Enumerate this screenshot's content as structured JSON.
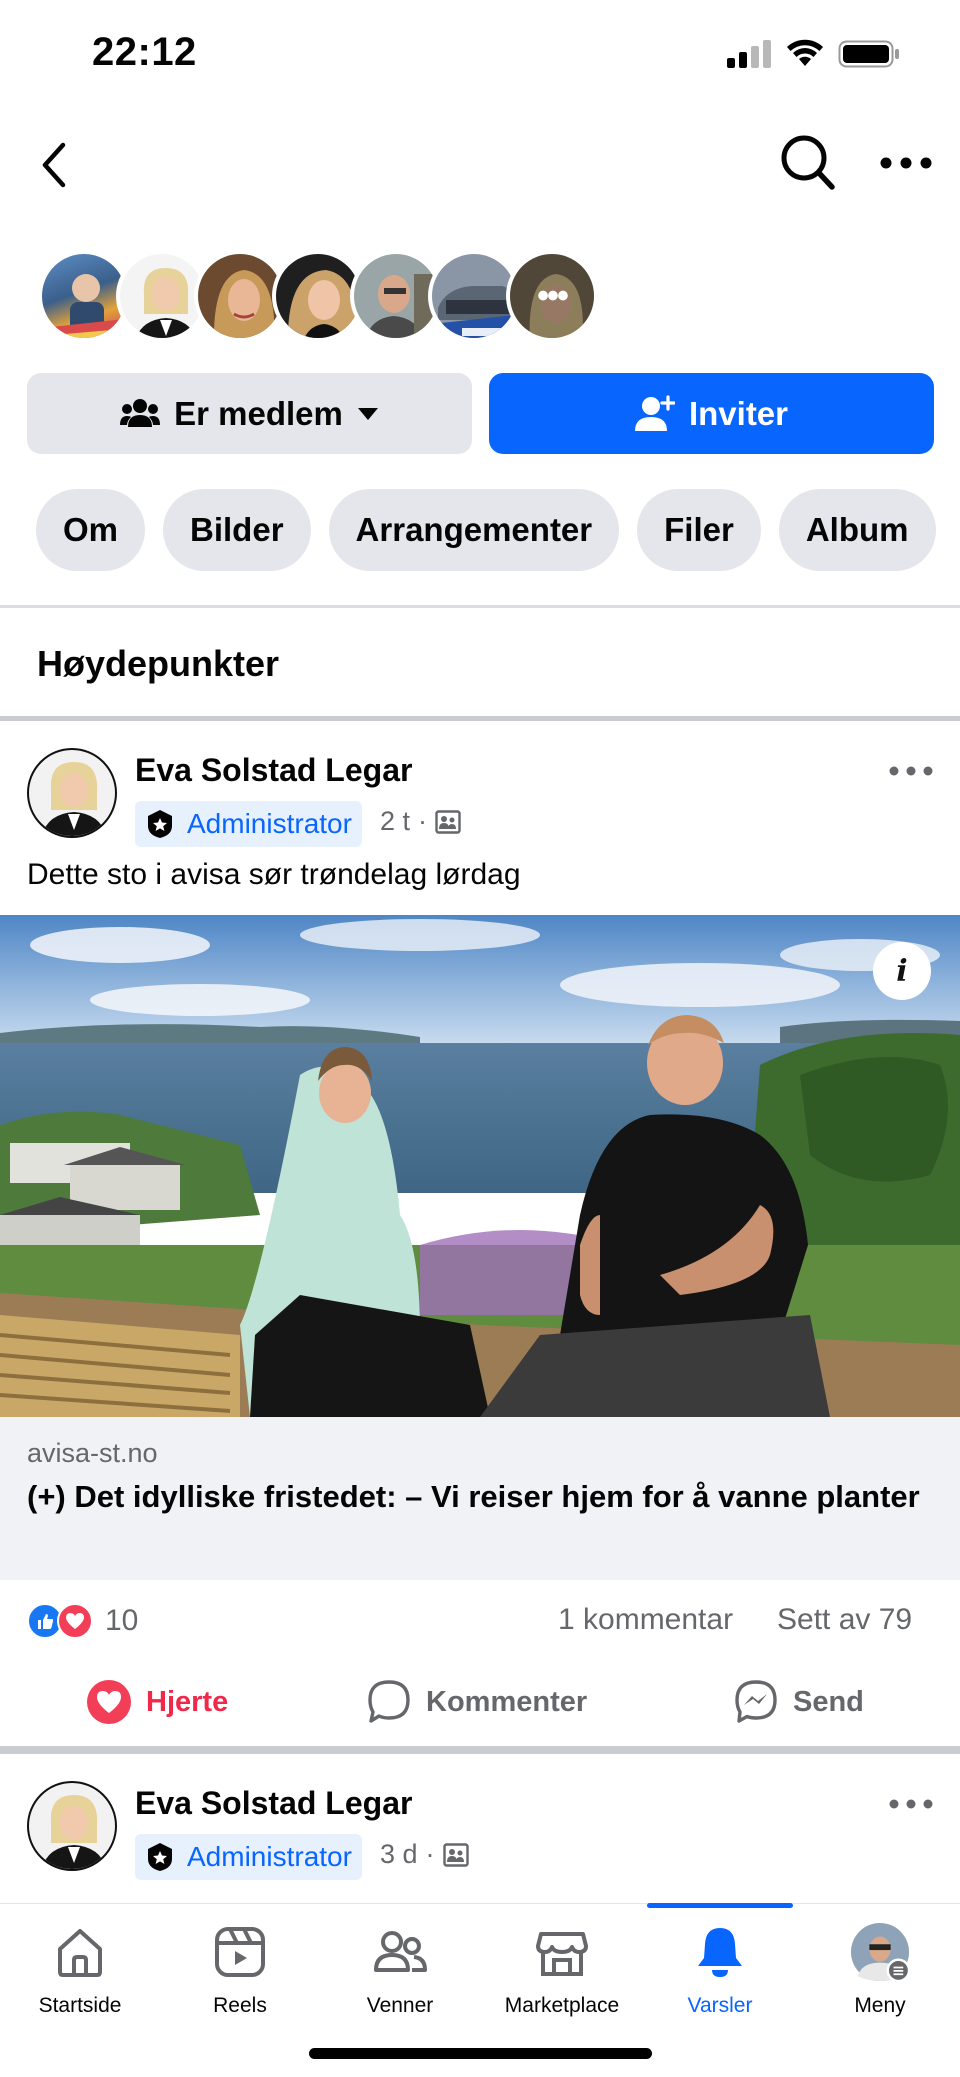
{
  "status_bar": {
    "time": "22:12"
  },
  "group_header": {
    "member_avatars": [
      "member-1",
      "member-2",
      "member-3",
      "member-4",
      "member-5",
      "member-6",
      "member-7"
    ],
    "more_members_glyph": "•••",
    "member_button_label": "Er medlem",
    "invite_button_label": "Inviter"
  },
  "tabs": [
    "Om",
    "Bilder",
    "Arrangementer",
    "Filer",
    "Album"
  ],
  "section_title": "Høydepunkter",
  "posts": [
    {
      "author": "Eva Solstad Legar",
      "role": "Administrator",
      "time": "2 t",
      "separator": "·",
      "text": "Dette sto i avisa sør trøndelag lørdag",
      "link": {
        "domain": "avisa-st.no",
        "title": "(+) Det idylliske fristedet: – Vi reiser hjem for å vanne planter"
      },
      "reaction_count": "10",
      "comments": "1 kommentar",
      "seen_by": "Sett av 79",
      "actions": {
        "like": "Hjerte",
        "comment": "Kommenter",
        "send": "Send"
      }
    },
    {
      "author": "Eva Solstad Legar",
      "role": "Administrator",
      "time": "3 d",
      "separator": "·"
    }
  ],
  "bottom_nav": [
    {
      "label": "Startside",
      "icon": "home-icon"
    },
    {
      "label": "Reels",
      "icon": "reels-icon"
    },
    {
      "label": "Venner",
      "icon": "friends-icon"
    },
    {
      "label": "Marketplace",
      "icon": "marketplace-icon"
    },
    {
      "label": "Varsler",
      "icon": "bell-icon",
      "active": true
    },
    {
      "label": "Meny",
      "icon": "profile-menu-icon"
    }
  ],
  "colors": {
    "accent": "#0866ff",
    "heart": "#f02849",
    "muted": "#65676b",
    "button_gray": "#e4e6eb"
  }
}
